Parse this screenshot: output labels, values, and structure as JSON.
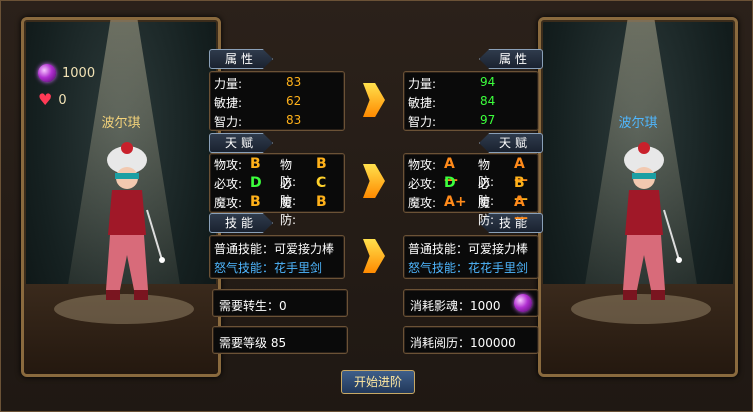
{
  "left": {
    "currency_gem": "1000",
    "currency_heart": "0",
    "char_name": "波尔琪"
  },
  "right": {
    "char_name": "波尔琪"
  },
  "headers": {
    "attr": "属性",
    "talent": "天赋",
    "skill": "技能"
  },
  "attr_left": [
    {
      "label": "力量:",
      "value": "83"
    },
    {
      "label": "敏捷:",
      "value": "62"
    },
    {
      "label": "智力:",
      "value": "83"
    }
  ],
  "attr_right": [
    {
      "label": "力量:",
      "value": "94"
    },
    {
      "label": "敏捷:",
      "value": "84"
    },
    {
      "label": "智力:",
      "value": "97"
    }
  ],
  "talent_left": [
    [
      {
        "label": "物攻:",
        "grade": "B"
      },
      {
        "label": "物防:",
        "grade": "B"
      }
    ],
    [
      {
        "label": "必攻:",
        "grade": "D"
      },
      {
        "label": "必防:",
        "grade": "C"
      }
    ],
    [
      {
        "label": "魔攻:",
        "grade": "B"
      },
      {
        "label": "魔防:",
        "grade": "B"
      }
    ]
  ],
  "talent_right": [
    [
      {
        "label": "物攻:",
        "grade": "A—"
      },
      {
        "label": "物防:",
        "grade": "A—"
      }
    ],
    [
      {
        "label": "必攻:",
        "grade": "D"
      },
      {
        "label": "必防:",
        "grade": "B—"
      }
    ],
    [
      {
        "label": "魔攻:",
        "grade": "A+"
      },
      {
        "label": "魔防:",
        "grade": "A—"
      }
    ]
  ],
  "skill_left": {
    "normal": "普通技能：可爱接力棒",
    "rage": "怒气技能：花手里剑"
  },
  "skill_right": {
    "normal": "普通技能：可爱接力棒",
    "rage": "怒气技能：花花手里剑"
  },
  "req_left": {
    "rebirth": "需要转生：0",
    "level": "需要等级  85"
  },
  "req_right": {
    "soul": "消耗影魂：1000",
    "exp": "消耗阅历：100000"
  },
  "button": "开始进阶"
}
